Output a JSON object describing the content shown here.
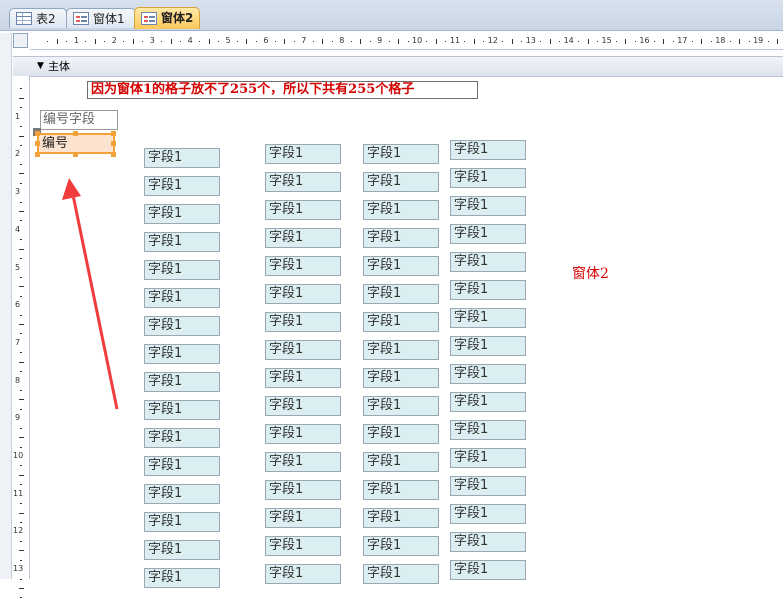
{
  "tabs": [
    {
      "label": "表2",
      "icon": "table-icon",
      "active": false
    },
    {
      "label": "窗体1",
      "icon": "form-icon",
      "active": false
    },
    {
      "label": "窗体2",
      "icon": "form-icon",
      "active": true
    }
  ],
  "ruler": {
    "numbers": [
      "1",
      "2",
      "3",
      "4",
      "5",
      "6",
      "7",
      "8",
      "9",
      "10",
      "11",
      "12",
      "13",
      "14",
      "15",
      "16",
      "17",
      "18",
      "19"
    ],
    "v_numbers": [
      "1",
      "2",
      "3",
      "4",
      "5",
      "6",
      "7",
      "8",
      "9",
      "10",
      "11",
      "12",
      "13"
    ]
  },
  "section": {
    "label": "主体"
  },
  "note": {
    "text": "因为窗体1的格子放不了255个，所以下共有255个格子",
    "color": "#d40000"
  },
  "field_label": {
    "text": "编号字段"
  },
  "field_box": {
    "text": "编号"
  },
  "form_name": {
    "text": "窗体2",
    "color": "#d40000"
  },
  "field_text": "字段1",
  "colors": {
    "tab_active": "#ffc85a",
    "field_bg": "#dbeef2",
    "selection": "#f3a23a",
    "arrow": "#f03c3c"
  }
}
